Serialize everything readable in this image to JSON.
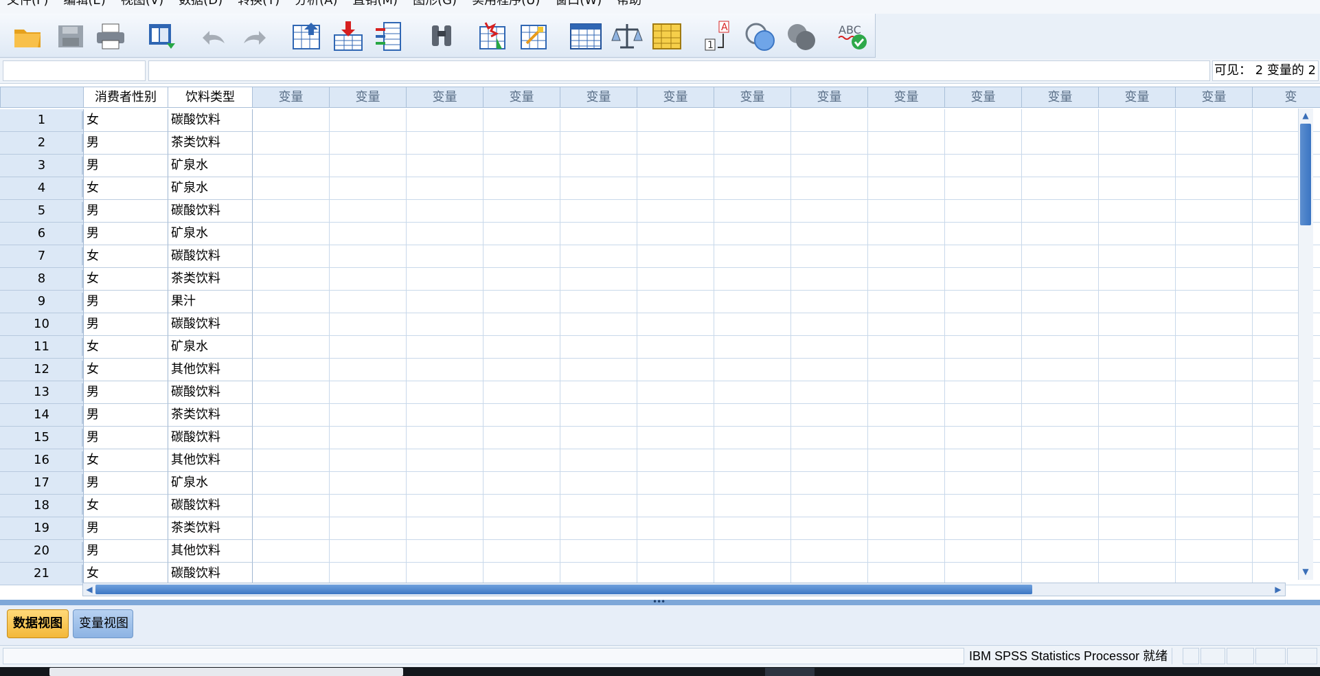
{
  "menu": [
    {
      "id": "file",
      "label": "文件(F)"
    },
    {
      "id": "edit",
      "label": "编辑(E)"
    },
    {
      "id": "view",
      "label": "视图(V)"
    },
    {
      "id": "data",
      "label": "数据(D)"
    },
    {
      "id": "transform",
      "label": "转换(T)"
    },
    {
      "id": "analyze",
      "label": "分析(A)"
    },
    {
      "id": "marketing",
      "label": "直销(M)"
    },
    {
      "id": "graphs",
      "label": "图形(G)"
    },
    {
      "id": "utilities",
      "label": "实用程序(U)"
    },
    {
      "id": "window",
      "label": "窗口(W)"
    },
    {
      "id": "help",
      "label": "帮助"
    }
  ],
  "toolbar_icons": [
    "open-icon",
    "save-icon",
    "print-icon",
    "recall-dialog-icon",
    "undo-icon",
    "redo-icon",
    "goto-case-icon",
    "goto-variable-icon",
    "variables-icon",
    "find-icon",
    "insert-cases-icon",
    "insert-variable-icon",
    "split-file-icon",
    "weight-cases-icon",
    "select-cases-icon",
    "value-labels-icon",
    "use-sets-icon",
    "show-all-variables-icon",
    "spell-check-icon"
  ],
  "cellbar": {
    "cell_ref": "",
    "cell_value": "",
    "visible_info": "可见： 2 变量的 2"
  },
  "grid": {
    "columns": [
      "消费者性别",
      "饮料类型",
      "变量",
      "变量",
      "变量",
      "变量",
      "变量",
      "变量",
      "变量",
      "变量",
      "变量",
      "变量",
      "变量",
      "变量",
      "变量",
      "变"
    ],
    "rows": [
      {
        "n": "1",
        "gender": "女",
        "drink": "碳酸饮料"
      },
      {
        "n": "2",
        "gender": "男",
        "drink": "茶类饮料"
      },
      {
        "n": "3",
        "gender": "男",
        "drink": "矿泉水"
      },
      {
        "n": "4",
        "gender": "女",
        "drink": "矿泉水"
      },
      {
        "n": "5",
        "gender": "男",
        "drink": "碳酸饮料"
      },
      {
        "n": "6",
        "gender": "男",
        "drink": "矿泉水"
      },
      {
        "n": "7",
        "gender": "女",
        "drink": "碳酸饮料"
      },
      {
        "n": "8",
        "gender": "女",
        "drink": "茶类饮料"
      },
      {
        "n": "9",
        "gender": "男",
        "drink": "果汁"
      },
      {
        "n": "10",
        "gender": "男",
        "drink": "碳酸饮料"
      },
      {
        "n": "11",
        "gender": "女",
        "drink": "矿泉水"
      },
      {
        "n": "12",
        "gender": "女",
        "drink": "其他饮料"
      },
      {
        "n": "13",
        "gender": "男",
        "drink": "碳酸饮料"
      },
      {
        "n": "14",
        "gender": "男",
        "drink": "茶类饮料"
      },
      {
        "n": "15",
        "gender": "男",
        "drink": "碳酸饮料"
      },
      {
        "n": "16",
        "gender": "女",
        "drink": "其他饮料"
      },
      {
        "n": "17",
        "gender": "男",
        "drink": "矿泉水"
      },
      {
        "n": "18",
        "gender": "女",
        "drink": "碳酸饮料"
      },
      {
        "n": "19",
        "gender": "男",
        "drink": "茶类饮料"
      },
      {
        "n": "20",
        "gender": "男",
        "drink": "其他饮料"
      },
      {
        "n": "21",
        "gender": "女",
        "drink": "碳酸饮料"
      }
    ]
  },
  "tabs": {
    "data_view": "数据视图",
    "variable_view": "变量视图",
    "active": "data_view"
  },
  "status": {
    "processor": "IBM SPSS Statistics Processor 就绪"
  },
  "colors": {
    "header_bg": "#dce8f6",
    "grid_line": "#c8d8ea",
    "active_tab": "#f3b83a",
    "scroll_thumb": "#3c76c3"
  }
}
